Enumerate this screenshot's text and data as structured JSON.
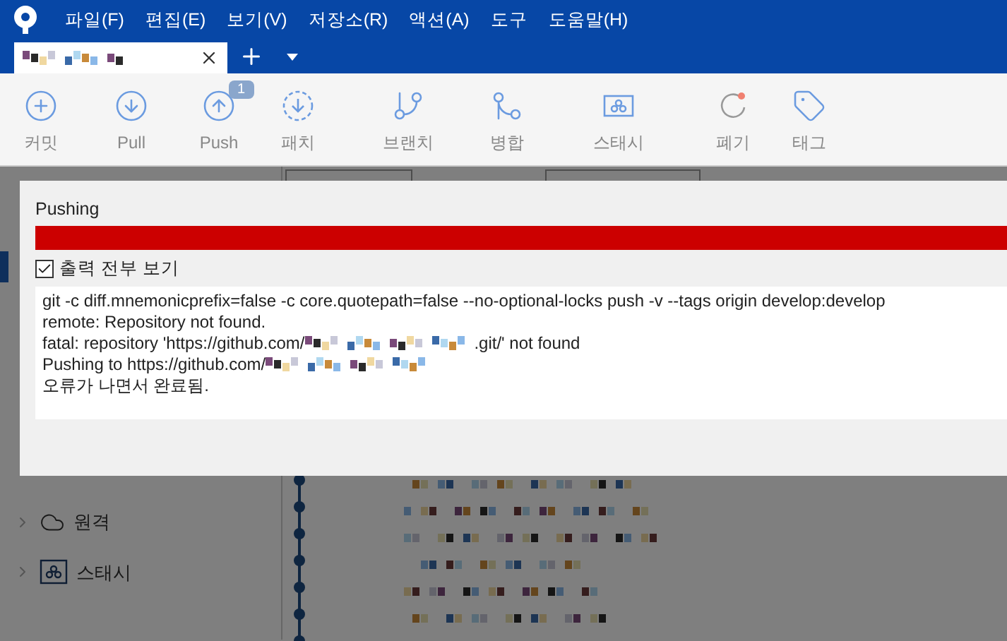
{
  "menu": [
    "파일(F)",
    "편집(E)",
    "보기(V)",
    "저장소(R)",
    "액션(A)",
    "도구",
    "도움말(H)"
  ],
  "tabs": [
    {
      "kind": "redacted",
      "selected": true
    }
  ],
  "toolbar": [
    {
      "label": "커밋",
      "kind": "commit"
    },
    {
      "label": "Pull",
      "kind": "pull"
    },
    {
      "label": "Push",
      "kind": "push",
      "badge": "1"
    },
    {
      "label": "패치",
      "kind": "fetch"
    },
    {
      "label": "브랜치",
      "kind": "branch"
    },
    {
      "label": "병합",
      "kind": "merge"
    },
    {
      "label": "스태시",
      "kind": "stash"
    },
    {
      "label": "폐기",
      "kind": "discard"
    },
    {
      "label": "태그",
      "kind": "tag"
    }
  ],
  "sidebar": [
    {
      "label": "원격",
      "kind": "remote"
    },
    {
      "label": "스태시",
      "kind": "stash"
    }
  ],
  "dialog": {
    "title": "Pushing",
    "progress": {
      "level": 1,
      "failed": true
    },
    "show_full_output": {
      "label": "출력 전부 보기",
      "checked": true
    },
    "output": [
      [
        {
          "kind": "text",
          "text": "git -c diff.mnemonicprefix=false -c core.quotepath=false --no-optional-locks push -v --tags origin develop:develop"
        }
      ],
      [
        {
          "kind": "text",
          "text": "remote: Repository not found."
        }
      ],
      [
        {
          "kind": "text",
          "text": "fatal: repository 'https://github.com/"
        },
        {
          "kind": "redacted"
        },
        {
          "kind": "text",
          "text": ".git/' not found"
        }
      ],
      [
        {
          "kind": "text",
          "text": "Pushing to https://github.com/"
        },
        {
          "kind": "redacted"
        }
      ],
      [
        {
          "kind": "text",
          "text": "오류가 나면서 완료됨."
        }
      ]
    ]
  }
}
